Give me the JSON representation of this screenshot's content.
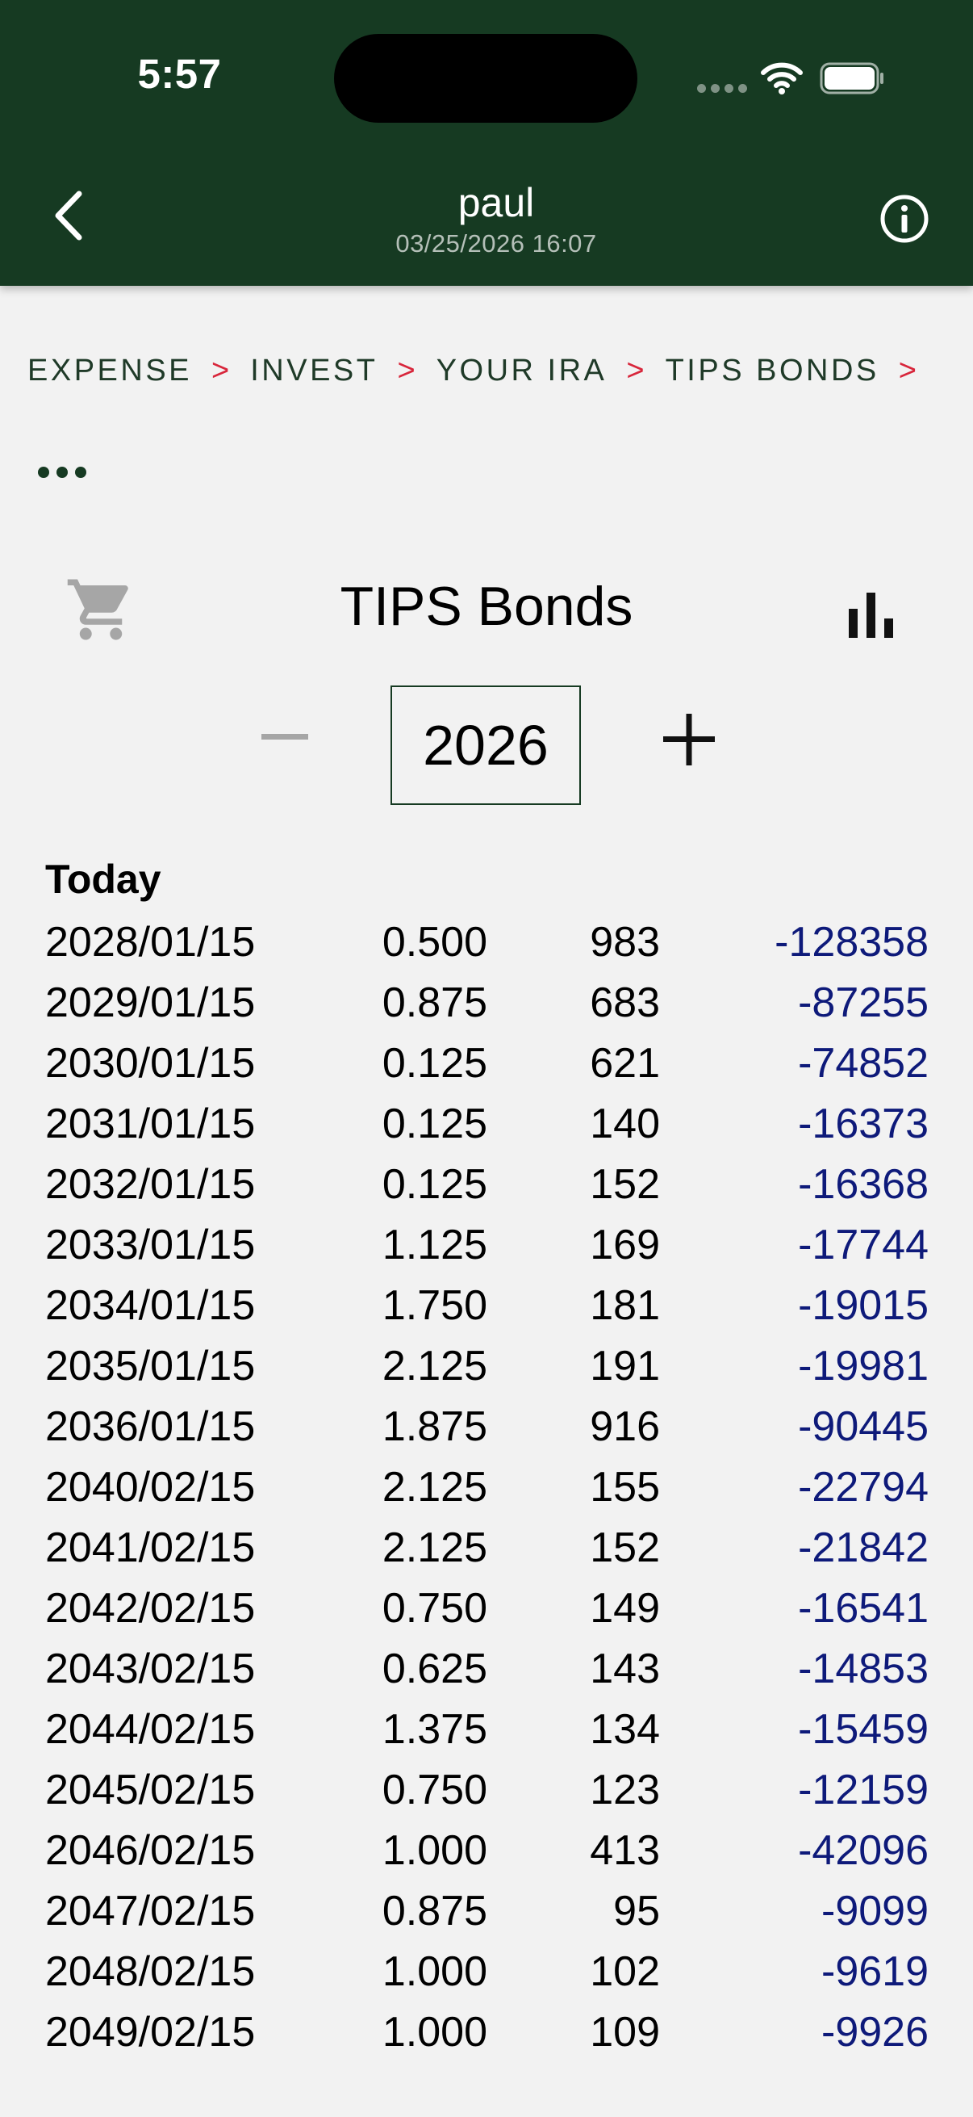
{
  "status_bar": {
    "time": "5:57"
  },
  "header": {
    "user": "paul",
    "timestamp": "03/25/2026 16:07",
    "back_icon": "chevron-left-icon",
    "info_icon": "info-circle-icon"
  },
  "breadcrumb": {
    "items": [
      "EXPENSE",
      "INVEST",
      "YOUR IRA",
      "TIPS BONDS"
    ],
    "separator": ">"
  },
  "toolbar": {
    "more_icon": "ellipsis-icon",
    "cart_icon": "shopping-cart-icon",
    "chart_icon": "bar-chart-icon",
    "title": "TIPS Bonds"
  },
  "year_stepper": {
    "value": "2026",
    "minus_enabled": false
  },
  "list": {
    "section_label": "Today",
    "rows": [
      {
        "date": "2028/01/15",
        "rate": "0.500",
        "qty": "983",
        "amount": "-128358"
      },
      {
        "date": "2029/01/15",
        "rate": "0.875",
        "qty": "683",
        "amount": "-87255"
      },
      {
        "date": "2030/01/15",
        "rate": "0.125",
        "qty": "621",
        "amount": "-74852"
      },
      {
        "date": "2031/01/15",
        "rate": "0.125",
        "qty": "140",
        "amount": "-16373"
      },
      {
        "date": "2032/01/15",
        "rate": "0.125",
        "qty": "152",
        "amount": "-16368"
      },
      {
        "date": "2033/01/15",
        "rate": "1.125",
        "qty": "169",
        "amount": "-17744"
      },
      {
        "date": "2034/01/15",
        "rate": "1.750",
        "qty": "181",
        "amount": "-19015"
      },
      {
        "date": "2035/01/15",
        "rate": "2.125",
        "qty": "191",
        "amount": "-19981"
      },
      {
        "date": "2036/01/15",
        "rate": "1.875",
        "qty": "916",
        "amount": "-90445"
      },
      {
        "date": "2040/02/15",
        "rate": "2.125",
        "qty": "155",
        "amount": "-22794"
      },
      {
        "date": "2041/02/15",
        "rate": "2.125",
        "qty": "152",
        "amount": "-21842"
      },
      {
        "date": "2042/02/15",
        "rate": "0.750",
        "qty": "149",
        "amount": "-16541"
      },
      {
        "date": "2043/02/15",
        "rate": "0.625",
        "qty": "143",
        "amount": "-14853"
      },
      {
        "date": "2044/02/15",
        "rate": "1.375",
        "qty": "134",
        "amount": "-15459"
      },
      {
        "date": "2045/02/15",
        "rate": "0.750",
        "qty": "123",
        "amount": "-12159"
      },
      {
        "date": "2046/02/15",
        "rate": "1.000",
        "qty": "413",
        "amount": "-42096"
      },
      {
        "date": "2047/02/15",
        "rate": "0.875",
        "qty": "95",
        "amount": "-9099"
      },
      {
        "date": "2048/02/15",
        "rate": "1.000",
        "qty": "102",
        "amount": "-9619"
      },
      {
        "date": "2049/02/15",
        "rate": "1.000",
        "qty": "109",
        "amount": "-9926"
      }
    ]
  },
  "colors": {
    "header_bg": "#163a22",
    "page_bg": "#f2f2f2",
    "breadcrumb_text": "#1f3a28",
    "breadcrumb_separator": "#d8263b",
    "amount_text": "#0e1a7a",
    "disabled_icon": "#a6a6a6"
  }
}
